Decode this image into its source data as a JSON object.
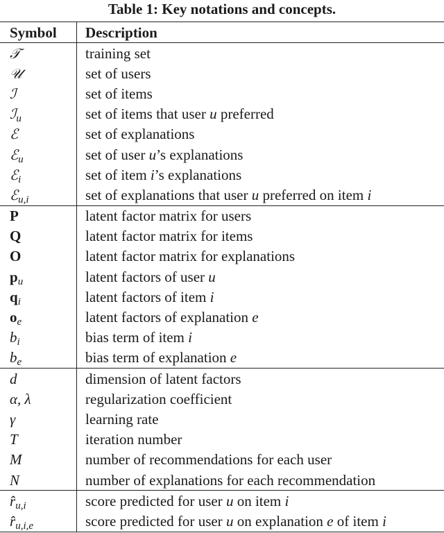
{
  "caption": "Table 1: Key notations and concepts.",
  "table": {
    "headers": {
      "symbol": "Symbol",
      "description": "Description"
    },
    "groups": [
      {
        "rows": [
          {
            "symbol": "𝒯",
            "base": "𝒯",
            "sub": "",
            "style": "cal",
            "description": "training set"
          },
          {
            "symbol": "𝒰",
            "base": "𝒰",
            "sub": "",
            "style": "cal",
            "description": "set of users"
          },
          {
            "symbol": "ℐ",
            "base": "ℐ",
            "sub": "",
            "style": "cal",
            "description": "set of items"
          },
          {
            "symbol": "ℐ_u",
            "base": "ℐ",
            "sub": "u",
            "style": "cal",
            "description": "set of items that user u preferred"
          },
          {
            "symbol": "ℰ",
            "base": "ℰ",
            "sub": "",
            "style": "cal",
            "description": "set of explanations"
          },
          {
            "symbol": "ℰ_u",
            "base": "ℰ",
            "sub": "u",
            "style": "cal",
            "description": "set of user u’s explanations"
          },
          {
            "symbol": "ℰ_i",
            "base": "ℰ",
            "sub": "i",
            "style": "cal",
            "description": "set of item i’s explanations"
          },
          {
            "symbol": "ℰ_u,i",
            "base": "ℰ",
            "sub": "u,i",
            "style": "cal",
            "description": "set of explanations that user u preferred on item i"
          }
        ]
      },
      {
        "rows": [
          {
            "symbol": "P",
            "base": "P",
            "sub": "",
            "style": "bold",
            "description": "latent factor matrix for users"
          },
          {
            "symbol": "Q",
            "base": "Q",
            "sub": "",
            "style": "bold",
            "description": "latent factor matrix for items"
          },
          {
            "symbol": "O",
            "base": "O",
            "sub": "",
            "style": "bold",
            "description": "latent factor matrix for explanations"
          },
          {
            "symbol": "p_u",
            "base": "p",
            "sub": "u",
            "style": "bold",
            "description": "latent factors of user u"
          },
          {
            "symbol": "q_i",
            "base": "q",
            "sub": "i",
            "style": "bold",
            "description": "latent factors of item i"
          },
          {
            "symbol": "o_e",
            "base": "o",
            "sub": "e",
            "style": "bold",
            "description": "latent factors of explanation e"
          },
          {
            "symbol": "b_i",
            "base": "b",
            "sub": "i",
            "style": "italic",
            "description": "bias term of item i"
          },
          {
            "symbol": "b_e",
            "base": "b",
            "sub": "e",
            "style": "italic",
            "description": "bias term of explanation e"
          }
        ]
      },
      {
        "rows": [
          {
            "symbol": "d",
            "base": "d",
            "sub": "",
            "style": "italic",
            "description": "dimension of latent factors"
          },
          {
            "symbol": "α, λ",
            "base": "α, λ",
            "sub": "",
            "style": "italic",
            "description": "regularization coefficient"
          },
          {
            "symbol": "γ",
            "base": "γ",
            "sub": "",
            "style": "italic",
            "description": "learning rate"
          },
          {
            "symbol": "T",
            "base": "T",
            "sub": "",
            "style": "italic",
            "description": "iteration number"
          },
          {
            "symbol": "M",
            "base": "M",
            "sub": "",
            "style": "italic",
            "description": "number of recommendations for each user"
          },
          {
            "symbol": "N",
            "base": "N",
            "sub": "",
            "style": "italic",
            "description": "number of explanations for each recommendation"
          }
        ]
      },
      {
        "rows": [
          {
            "symbol": "r̂_u,i",
            "base": "r̂",
            "sub": "u,i",
            "style": "italic",
            "description": "score predicted for user u on item i"
          },
          {
            "symbol": "r̂_u,i,e",
            "base": "r̂",
            "sub": "u,i,e",
            "style": "italic",
            "description": "score predicted for user u on explanation e of item i"
          }
        ]
      }
    ]
  }
}
